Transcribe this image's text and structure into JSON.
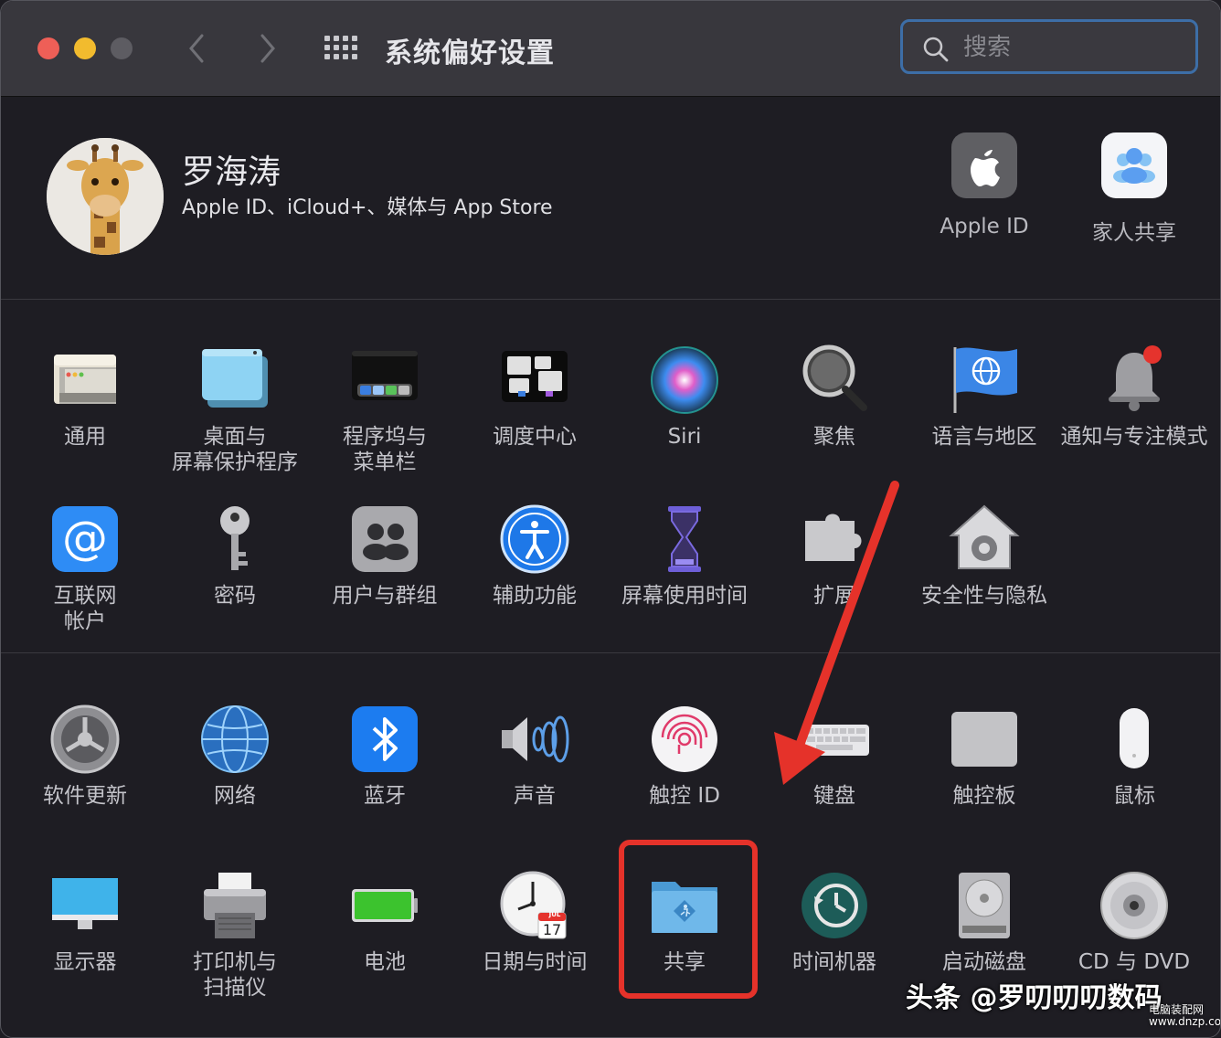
{
  "window": {
    "title": "系统偏好设置",
    "search_placeholder": "搜索"
  },
  "account": {
    "name": "罗海涛",
    "subtitle": "Apple ID、iCloud+、媒体与 App Store",
    "items": [
      {
        "label": "Apple ID",
        "icon": "apple-id-icon"
      },
      {
        "label": "家人共享",
        "icon": "family-sharing-icon"
      }
    ]
  },
  "section1": [
    {
      "label": "通用",
      "icon": "general-icon"
    },
    {
      "label": "桌面与\n屏幕保护程序",
      "icon": "desktop-screensaver-icon"
    },
    {
      "label": "程序坞与\n菜单栏",
      "icon": "dock-menubar-icon"
    },
    {
      "label": "调度中心",
      "icon": "mission-control-icon"
    },
    {
      "label": "Siri",
      "icon": "siri-icon"
    },
    {
      "label": "聚焦",
      "icon": "spotlight-icon"
    },
    {
      "label": "语言与地区",
      "icon": "language-region-icon"
    },
    {
      "label": "通知与专注模式",
      "icon": "notifications-icon"
    },
    {
      "label": "互联网\n帐户",
      "icon": "internet-accounts-icon"
    },
    {
      "label": "密码",
      "icon": "passwords-icon"
    },
    {
      "label": "用户与群组",
      "icon": "users-groups-icon"
    },
    {
      "label": "辅助功能",
      "icon": "accessibility-icon"
    },
    {
      "label": "屏幕使用时间",
      "icon": "screen-time-icon"
    },
    {
      "label": "扩展",
      "icon": "extensions-icon"
    },
    {
      "label": "安全性与隐私",
      "icon": "security-privacy-icon"
    }
  ],
  "section2": [
    {
      "label": "软件更新",
      "icon": "software-update-icon"
    },
    {
      "label": "网络",
      "icon": "network-icon"
    },
    {
      "label": "蓝牙",
      "icon": "bluetooth-icon"
    },
    {
      "label": "声音",
      "icon": "sound-icon"
    },
    {
      "label": "触控 ID",
      "icon": "touch-id-icon"
    },
    {
      "label": "键盘",
      "icon": "keyboard-icon"
    },
    {
      "label": "触控板",
      "icon": "trackpad-icon"
    },
    {
      "label": "鼠标",
      "icon": "mouse-icon"
    },
    {
      "label": "显示器",
      "icon": "displays-icon"
    },
    {
      "label": "打印机与\n扫描仪",
      "icon": "printers-scanners-icon"
    },
    {
      "label": "电池",
      "icon": "battery-icon"
    },
    {
      "label": "日期与时间",
      "icon": "date-time-icon"
    },
    {
      "label": "共享",
      "icon": "sharing-icon"
    },
    {
      "label": "时间机器",
      "icon": "time-machine-icon"
    },
    {
      "label": "启动磁盘",
      "icon": "startup-disk-icon"
    },
    {
      "label": "CD 与 DVD",
      "icon": "cd-dvd-icon"
    }
  ],
  "calendar": {
    "month": "JUL",
    "day": "17"
  },
  "watermark": {
    "text": "头条 @罗叨叨叨数码",
    "site": "电脑装配网\nwww.dnzp.com"
  },
  "colors": {
    "highlight": "#e5322a",
    "accent": "#3d6ea7"
  }
}
